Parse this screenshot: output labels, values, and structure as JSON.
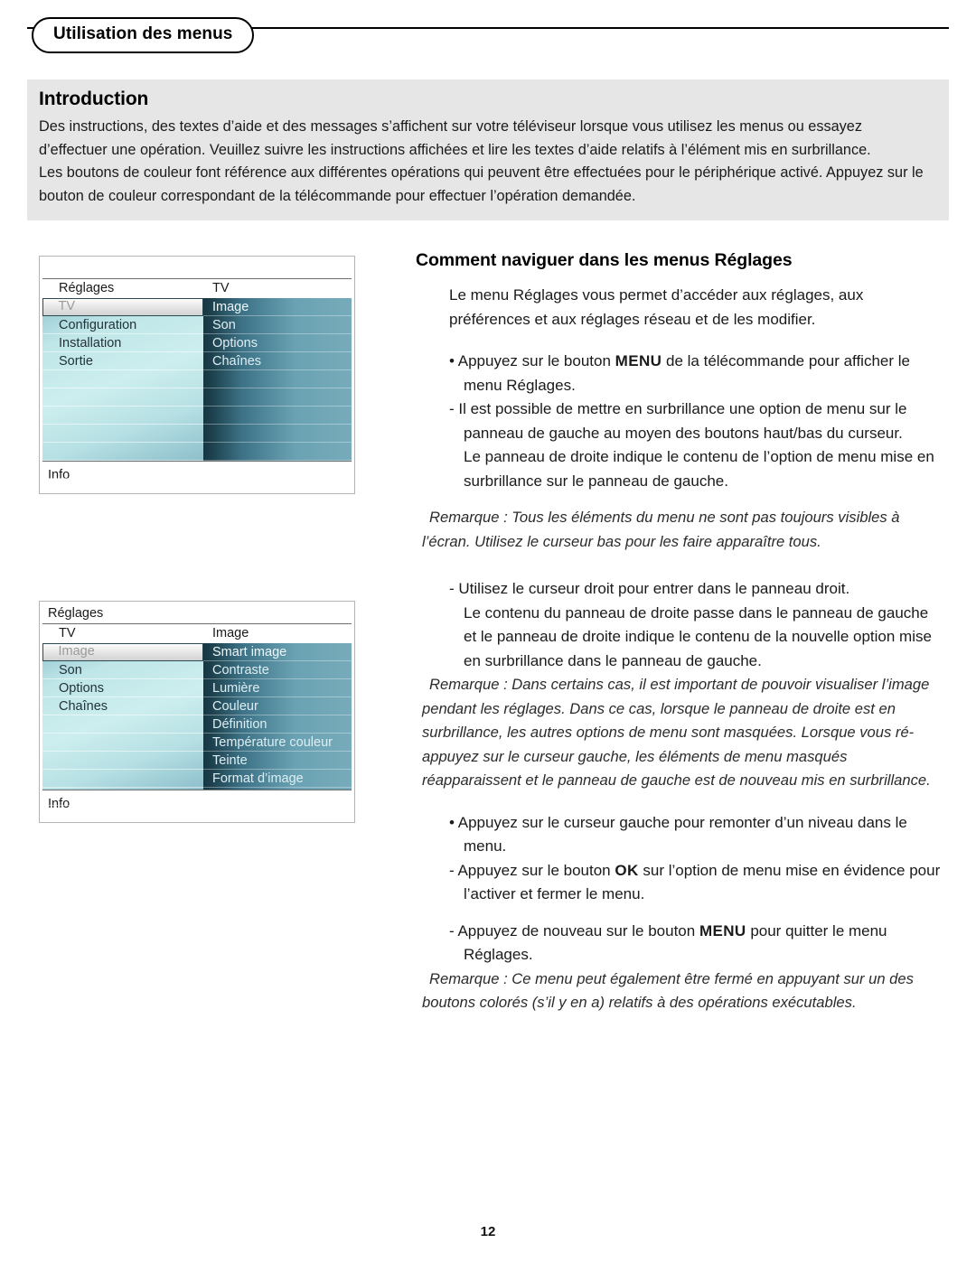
{
  "header": {
    "chapter_tab": "Utilisation des menus"
  },
  "intro": {
    "title": "Introduction",
    "paragraphs": [
      "Des instructions, des textes d’aide et des messages s’affichent sur votre téléviseur lorsque vous utilisez les menus ou essayez d’effectuer une opération. Veuillez suivre les instructions affichées et lire les textes d’aide relatifs à l’élément mis en surbrillance.",
      "Les boutons de couleur font référence aux différentes opérations qui peuvent être effectuées pour le périphérique activé. Appuyez sur le bouton de couleur correspondant de la télécommande pour effectuer l’opération demandée."
    ]
  },
  "section": {
    "title": "Comment naviguer dans les menus Réglages",
    "lead": "Le menu Réglages vous permet d’accéder aux réglages, aux préférences et aux réglages réseau et de les modifier.",
    "b1_pre": "• Appuyez sur le bouton ",
    "b1_kbd": "MENU",
    "b1_post": " de la télécommande pour afficher le menu Réglages.",
    "b2": "- Il est possible de mettre en surbrillance une option de menu sur le panneau de gauche au moyen des boutons haut/bas du curseur.",
    "b2_cont": "Le panneau de droite indique le contenu de l’option de menu mise en surbrillance sur le panneau de gauche.",
    "note1": "Remarque : Tous les éléments du menu ne sont pas toujours visibles à l’écran. Utilisez le curseur bas pour les faire apparaître tous.",
    "b3": "- Utilisez le curseur droit pour entrer dans le panneau droit.",
    "b3_cont": "Le contenu du panneau de droite passe dans le panneau de gauche et le panneau de droite indique le contenu de la nouvelle option mise en surbrillance dans le panneau de gauche.",
    "note2": "Remarque : Dans certains cas, il est important de pouvoir visualiser l’image pendant les réglages. Dans ce cas, lorsque le panneau de droite est en surbrillance, les autres options de menu sont masquées. Lorsque vous ré-appuyez sur le curseur gauche, les éléments de menu masqués réapparaissent et le panneau de gauche est de nouveau mis en surbrillance.",
    "b4": "• Appuyez sur le curseur gauche pour remonter d’un niveau dans le menu.",
    "b5_pre": "- Appuyez sur le bouton ",
    "b5_kbd": "OK",
    "b5_post": " sur l’option de menu mise en évidence pour l’activer et fermer le menu.",
    "b6_pre": "- Appuyez de nouveau sur le bouton ",
    "b6_kbd": "MENU",
    "b6_post": " pour quitter le menu Réglages.",
    "note3": "Remarque : Ce menu peut également être fermé en appuyant sur un des boutons colorés (s’il y en a) relatifs à des opérations exécutables."
  },
  "menu_mock_1": {
    "titlebar": "",
    "col_head_left": "Réglages",
    "col_head_right": "TV",
    "left_items": [
      "TV",
      "Configuration",
      "Installation",
      "Sortie",
      "",
      "",
      "",
      "",
      "",
      ""
    ],
    "left_selected_index": 0,
    "right_items": [
      "Image",
      "Son",
      "Options",
      "Chaînes",
      "",
      "",
      "",
      "",
      "",
      ""
    ],
    "right_selected_index": 0,
    "infobar": "Info"
  },
  "menu_mock_2": {
    "titlebar": "Réglages",
    "col_head_left": "TV",
    "col_head_right": "Image",
    "left_items": [
      "Image",
      "Son",
      "Options",
      "Chaînes",
      "",
      "",
      "",
      "",
      ""
    ],
    "left_selected_index": 0,
    "right_items": [
      "Smart image",
      "Contraste",
      "Lumière",
      "Couleur",
      "Définition",
      "Température couleur",
      "Teinte",
      "Format d’image",
      ""
    ],
    "right_selected_index": 0,
    "infobar": "Info"
  },
  "footer": {
    "page_number": "12"
  },
  "colors": {
    "intro_background": "#e6e6e6",
    "panel_left_light": "#cdeeee",
    "panel_left_dark": "#8dbfcb",
    "panel_right_dark": "#163642",
    "panel_right_light": "#77abba",
    "selection_border": "#2b4a52"
  }
}
